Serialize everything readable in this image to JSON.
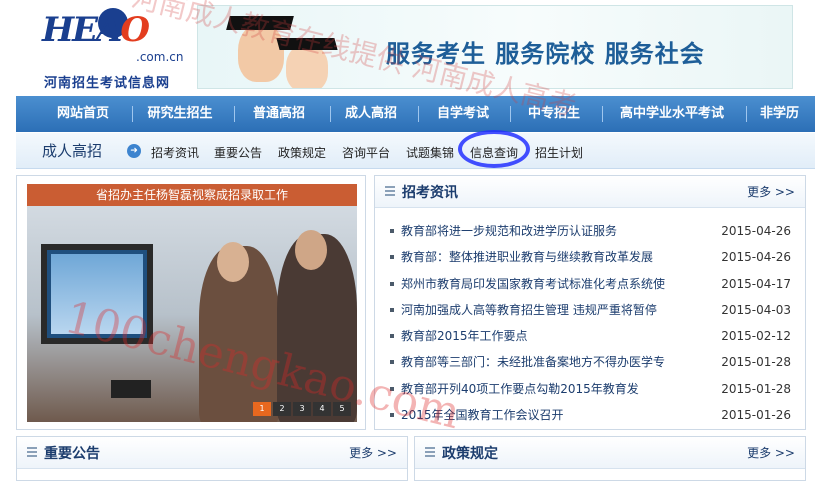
{
  "header": {
    "logo_mark_a": "HEA",
    "logo_mark_b": "O",
    "logo_domain": ".com.cn",
    "logo_text": "河南招生考试信息网",
    "slogan": "服务考生  服务院校  服务社会"
  },
  "nav": {
    "items": [
      "网站首页",
      "研究生招生",
      "普通高招",
      "成人高招",
      "自学考试",
      "中专招生",
      "高中学业水平考试",
      "非学历"
    ]
  },
  "subnav": {
    "title": "成人高招",
    "links": [
      "招考资讯",
      "重要公告",
      "政策规定",
      "咨询平台",
      "试题集锦",
      "信息查询",
      "招生计划"
    ]
  },
  "photo": {
    "caption": "省招办主任杨智磊视察成招录取工作",
    "pages": [
      "1",
      "2",
      "3",
      "4",
      "5"
    ]
  },
  "news": {
    "title": "招考资讯",
    "more": "更多 >>",
    "items": [
      {
        "title": "教育部将进一步规范和改进学历认证服务",
        "date": "2015-04-26"
      },
      {
        "title": "教育部：整体推进职业教育与继续教育改革发展",
        "date": "2015-04-26"
      },
      {
        "title": "郑州市教育局印发国家教育考试标准化考点系统使",
        "date": "2015-04-17"
      },
      {
        "title": "河南加强成人高等教育招生管理 违规严重将暂停",
        "date": "2015-04-03"
      },
      {
        "title": "教育部2015年工作要点",
        "date": "2015-02-12"
      },
      {
        "title": "教育部等三部门：未经批准备案地方不得办医学专",
        "date": "2015-01-28"
      },
      {
        "title": "教育部开列40项工作要点勾勒2015年教育发",
        "date": "2015-01-28"
      },
      {
        "title": "2015年全国教育工作会议召开",
        "date": "2015-01-26"
      }
    ]
  },
  "notices": {
    "title": "重要公告",
    "more": "更多 >>"
  },
  "policy": {
    "title": "政策规定",
    "more": "更多 >>"
  },
  "watermark": {
    "url": "100chengkao.com",
    "cn": "河南成人教育在线提供 河南成人高考"
  }
}
